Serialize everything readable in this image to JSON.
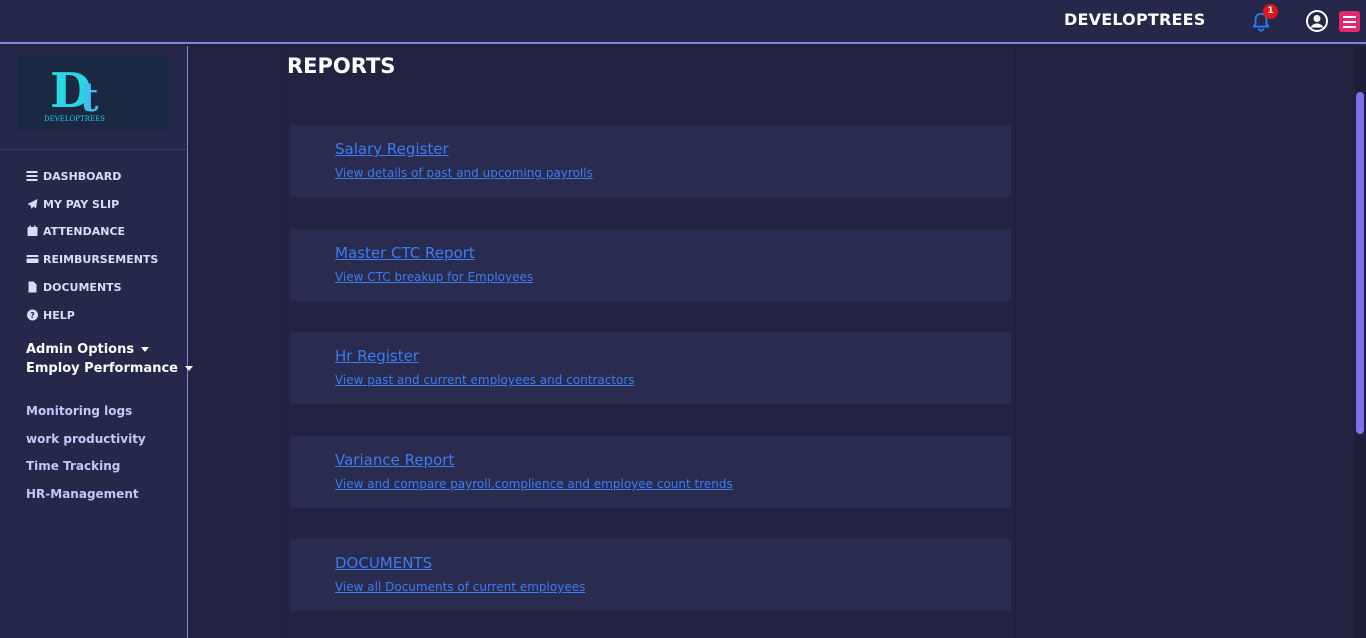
{
  "header": {
    "brand": "DEVELOPTREES",
    "notification_count": "1"
  },
  "sidebar": {
    "logo_text": "DEVELOPTREES",
    "logo_initials": "Dt",
    "nav": [
      {
        "label": "DASHBOARD",
        "icon": "bars-icon"
      },
      {
        "label": "MY PAY SLIP",
        "icon": "paper-plane-icon"
      },
      {
        "label": "ATTENDANCE",
        "icon": "calendar-icon"
      },
      {
        "label": "REIMBURSEMENTS",
        "icon": "credit-card-icon"
      },
      {
        "label": "DOCUMENTS",
        "icon": "file-icon"
      },
      {
        "label": "HELP",
        "icon": "question-circle-icon"
      }
    ],
    "admin_options": "Admin Options",
    "employ_performance": "Employ Performance",
    "links": [
      "Monitoring logs",
      "work productivity",
      "Time Tracking",
      "HR-Management"
    ]
  },
  "main": {
    "title": "REPORTS",
    "reports": [
      {
        "title": "Salary Register",
        "description": "View details of past and upcoming payrolls"
      },
      {
        "title": "Master CTC Report",
        "description": "View CTC breakup for Employees"
      },
      {
        "title": "Hr Register",
        "description": "View past and current employees and contractors"
      },
      {
        "title": "Variance Report",
        "description": "View and compare payroll,complience and employee count trends"
      },
      {
        "title": "DOCUMENTS",
        "description": "View all Documents of current employees"
      }
    ]
  },
  "colors": {
    "background": "#212340",
    "panel": "#252849",
    "card": "#292c4f",
    "link": "#3d7bf0",
    "accent": "#8a7fe6",
    "menu_button": "#e5276f",
    "badge": "#e0161b"
  }
}
